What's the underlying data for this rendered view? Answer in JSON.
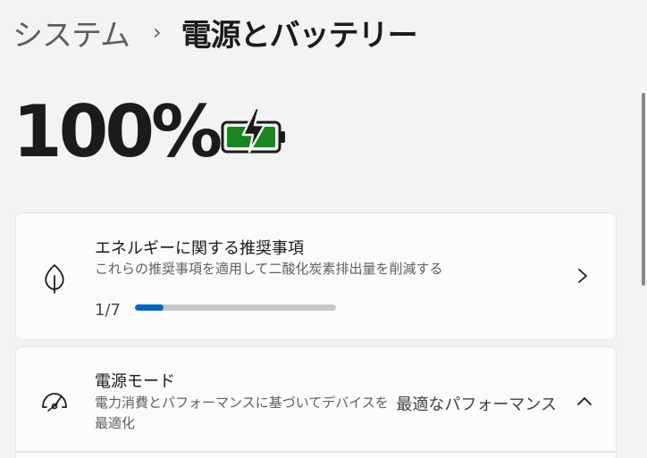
{
  "breadcrumb": {
    "parent": "システム",
    "separator": "›",
    "current": "電源とバッテリー"
  },
  "battery": {
    "percent_text": "100%",
    "level": 1.0,
    "icon": "battery-charging-icon",
    "color": "#19851e"
  },
  "energy_card": {
    "title": "エネルギーに関する推奨事項",
    "subtitle": "これらの推奨事項を適用して二酸化炭素排出量を削減する",
    "progress_label": "1/7",
    "progress_fraction": 0.142857,
    "icon": "leaf-icon",
    "accent_color": "#0067c0"
  },
  "power_mode_card": {
    "title": "電源モード",
    "subtitle_line1": "電力消費とパフォーマンスに基づいてデバイスを",
    "subtitle_line2": "最適化",
    "value": "最適なパフォーマンス",
    "icon": "speedometer-icon"
  }
}
